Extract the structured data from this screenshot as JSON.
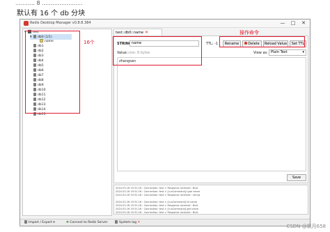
{
  "page": {
    "top_text": "........... 8 .......................",
    "heading": "默认有 16 个 db 分块",
    "watermark": "CSDN @飒月658"
  },
  "annotations": {
    "count_label": "16个",
    "ops_label": "操作命令"
  },
  "app": {
    "title": "Redis Desktop Manager v0.8.8.384",
    "window_controls": [
      "—",
      "□",
      "✕"
    ]
  },
  "tree": {
    "server": "test",
    "databases": [
      {
        "label": "db0",
        "count": "(1/1)",
        "selected": true,
        "expanded": true
      },
      {
        "label": "db1"
      },
      {
        "label": "db2"
      },
      {
        "label": "db3"
      },
      {
        "label": "db4"
      },
      {
        "label": "db5"
      },
      {
        "label": "db6"
      },
      {
        "label": "db7"
      },
      {
        "label": "db8"
      },
      {
        "label": "db9"
      },
      {
        "label": "db10"
      },
      {
        "label": "db11"
      },
      {
        "label": "db12"
      },
      {
        "label": "db13"
      },
      {
        "label": "db14"
      },
      {
        "label": "db15"
      }
    ],
    "key_under_db0": "name"
  },
  "tab": {
    "label": "test::db0::name"
  },
  "editor": {
    "type_label": "STRING:",
    "key_name": "name",
    "ttl_label": "TTL:",
    "ttl_value": "-1",
    "buttons": {
      "rename": "Rename",
      "delete": "Delete",
      "reload": "Reload Value",
      "set_ttl": "Set TTL"
    },
    "value_label": "Value:",
    "value_size": "size: 8 bytes",
    "view_as_label": "View as:",
    "view_as_value": "Plain Text",
    "value_text": "zhangsan",
    "save_label": "Save"
  },
  "log": {
    "lines": [
      "2024-03-16 19:31:16 : Connection: test > Response received : Bulk",
      "2024-03-16 19:31:16 : Connection: test > [runCommand] type name",
      "2024-03-16 19:31:16 : Connection: test > Response received : string",
      "",
      "2024-03-16 19:31:16 : Connection: test > [runCommand] ttl name",
      "2024-03-16 19:31:16 : Connection: test > Response received : Bulk",
      "2024-03-16 19:31:16 : Connection: test > [runCommand] get name",
      "2024-03-16 19:31:16 : Connection: test > Response received : Bulk"
    ]
  },
  "statusbar": {
    "import_export": "Import / Export",
    "connect": "Connect to Redis Server",
    "system_log": "System log"
  },
  "colors": {
    "annotation_red": "#e0182d"
  }
}
